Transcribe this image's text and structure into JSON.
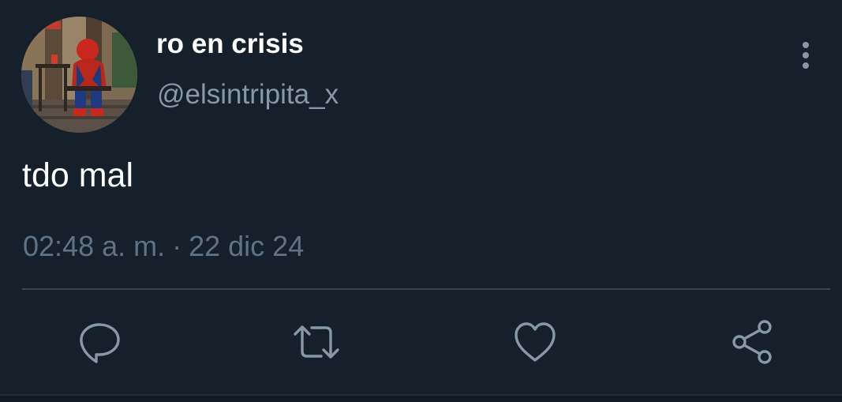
{
  "author": {
    "display_name": "ro en crisis",
    "handle": "@elsintripita_x",
    "avatar_icon": "avatar-photo"
  },
  "menu": {
    "icon": "more-vertical-icon"
  },
  "tweet": {
    "text": "tdo mal",
    "time": "02:48 a. m.",
    "separator": "·",
    "date": "22 dic 24"
  },
  "actions": [
    {
      "name": "reply",
      "icon": "reply-icon"
    },
    {
      "name": "retweet",
      "icon": "retweet-icon"
    },
    {
      "name": "like",
      "icon": "heart-icon"
    },
    {
      "name": "share",
      "icon": "share-icon"
    }
  ],
  "colors": {
    "background": "#15202b",
    "primary_text": "#ffffff",
    "secondary_text": "#8899a6",
    "divider": "#38444d"
  }
}
